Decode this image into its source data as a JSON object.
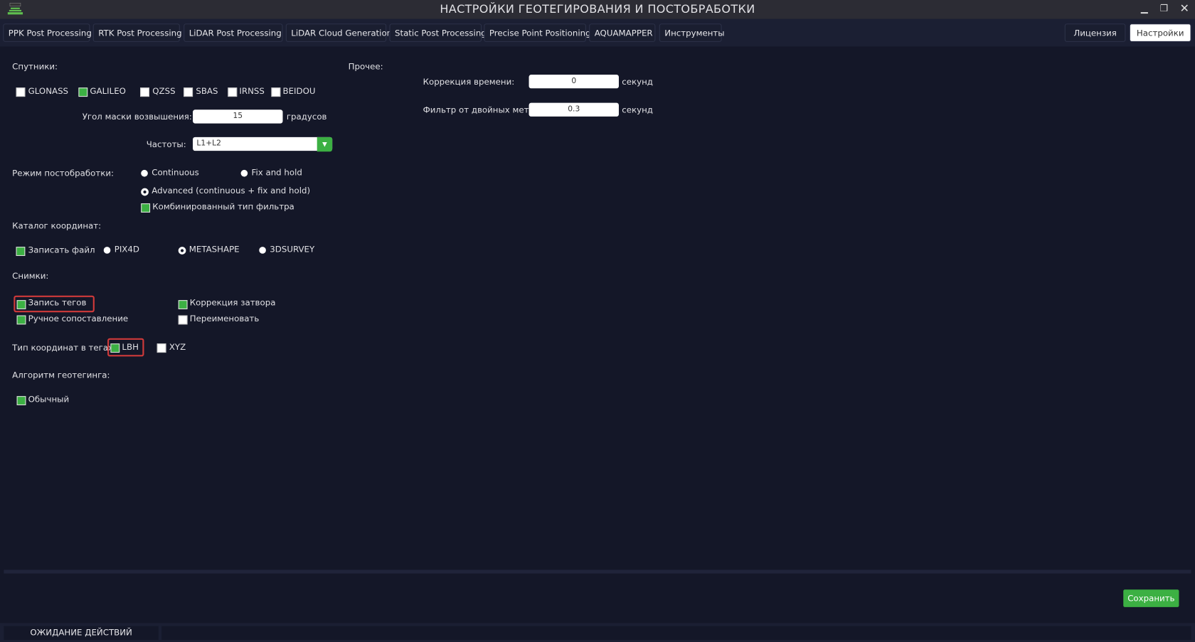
{
  "window": {
    "title": "НАСТРОЙКИ ГЕОТЕГИРОВАНИЯ И ПОСТОБРАБОТКИ"
  },
  "tabs": [
    "PPK Post Processing",
    "RTK Post Processing",
    "LiDAR Post Processing",
    "LiDAR Cloud Generation",
    "Static Post Processing",
    "Precise Point Positioning",
    "AQUAMAPPER",
    "Инструменты"
  ],
  "right_tabs": [
    "Лицензия",
    "Настройки"
  ],
  "active_tab": "Настройки",
  "satellites": {
    "label": "Спутники:",
    "items": [
      {
        "name": "GLONASS",
        "checked": false
      },
      {
        "name": "GALILEO",
        "checked": true
      },
      {
        "name": "QZSS",
        "checked": false
      },
      {
        "name": "SBAS",
        "checked": false
      },
      {
        "name": "IRNSS",
        "checked": false
      },
      {
        "name": "BEIDOU",
        "checked": false
      }
    ]
  },
  "elevation": {
    "label": "Угол маски возвышения:",
    "value": "15",
    "unit": "градусов"
  },
  "frequencies": {
    "label": "Частоты:",
    "value": "L1+L2"
  },
  "mode": {
    "label": "Режим постобработки:",
    "continuous": "Continuous",
    "fix_hold": "Fix and hold",
    "advanced": "Advanced (continuous + fix and hold)",
    "combined_filter": "Комбинированный тип фильтра",
    "selected": "advanced",
    "combined_checked": true
  },
  "catalog": {
    "label": "Каталог координат:",
    "write_file": "Записать файл",
    "write_checked": true,
    "options": [
      "PIX4D",
      "METASHAPE",
      "3DSURVEY"
    ],
    "selected": "METASHAPE"
  },
  "images": {
    "label": "Снимки:",
    "tag_write": "Запись тегов",
    "shutter": "Коррекция затвора",
    "manual": "Ручное сопоставление",
    "rename": "Переименовать",
    "tag_write_checked": true,
    "shutter_checked": true,
    "manual_checked": true,
    "rename_checked": false
  },
  "coord_type": {
    "label": "Тип координат в тегах:",
    "lbh": "LBH",
    "xyz": "XYZ",
    "lbh_checked": true,
    "xyz_checked": false
  },
  "algorithm": {
    "label": "Алгоритм геотегинга:",
    "normal": "Обычный",
    "normal_checked": true
  },
  "other": {
    "label": "Прочее:",
    "time_corr_label": "Коррекция времени:",
    "time_corr_value": "0",
    "time_unit": "секунд",
    "dup_filter_label": "Фильтр от двойных меток:",
    "dup_filter_value": "0.3",
    "dup_unit": "секунд"
  },
  "footer": {
    "save": "Сохранить",
    "status": "ОЖИДАНИЕ ДЕЙСТВИЙ"
  },
  "colors": {
    "accent": "#3cb043",
    "highlight": "#d03a3a",
    "background": "#141728"
  }
}
